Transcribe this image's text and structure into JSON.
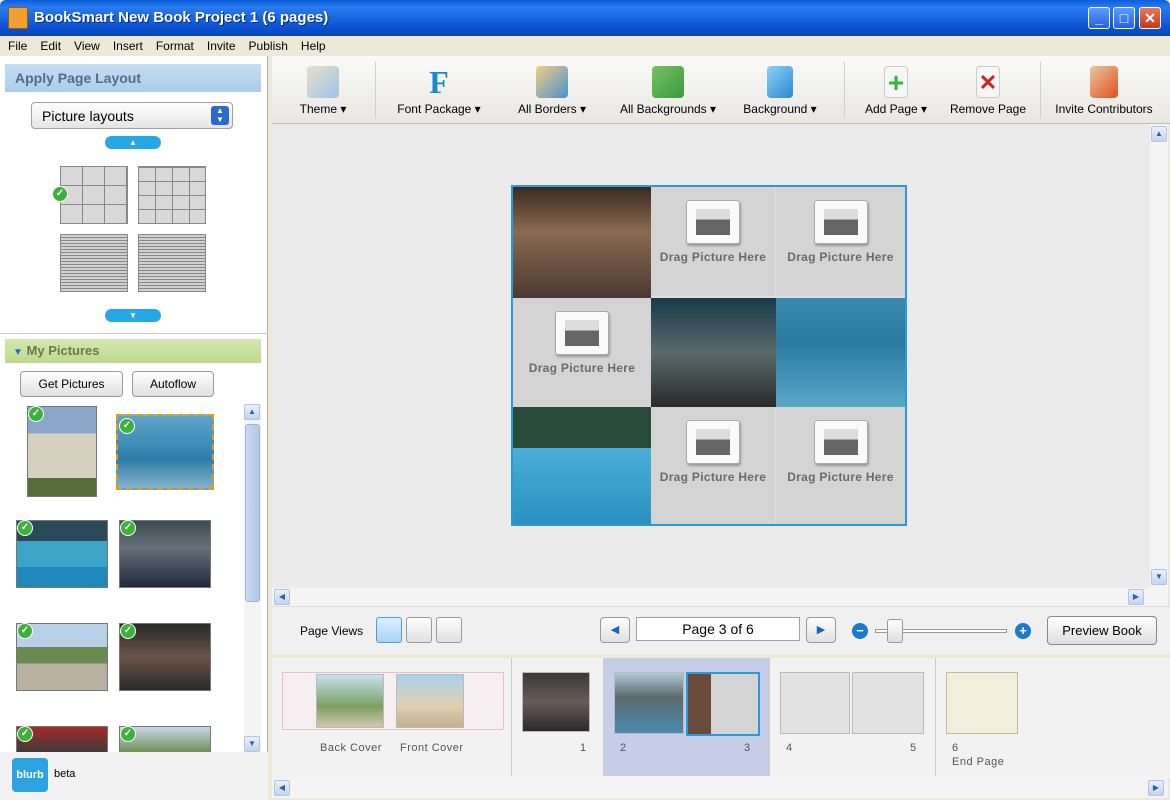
{
  "window": {
    "title": "BookSmart New Book Project 1 (6 pages)"
  },
  "menu": [
    "File",
    "Edit",
    "View",
    "Insert",
    "Format",
    "Invite",
    "Publish",
    "Help"
  ],
  "left_panel": {
    "apply_layout_title": "Apply Page Layout",
    "layout_select": "Picture layouts",
    "my_pictures_title": "My Pictures",
    "get_pictures_label": "Get Pictures",
    "autoflow_label": "Autoflow",
    "blurb_logo": "blurb",
    "blurb_beta": "beta"
  },
  "toolbar": {
    "theme": "Theme ▾",
    "font_package": "Font Package ▾",
    "all_borders": "All Borders ▾",
    "all_backgrounds": "All Backgrounds ▾",
    "background": "Background ▾",
    "add_page": "Add Page ▾",
    "remove_page": "Remove Page",
    "invite_contributors": "Invite Contributors"
  },
  "canvas": {
    "placeholder_text": "Drag Picture Here"
  },
  "page_views": {
    "label": "Page Views",
    "page_indicator": "Page 3 of 6",
    "preview_label": "Preview Book"
  },
  "filmstrip": {
    "back_cover": "Back Cover",
    "front_cover": "Front Cover",
    "p1": "1",
    "p2": "2",
    "p3": "3",
    "p4": "4",
    "p5": "5",
    "p6": "6",
    "end_page": "End Page"
  },
  "colors": {
    "accent": "#2a9ae0",
    "title_bar": "#0a5fd8",
    "selected_spread": "#c6cde6",
    "check": "#3cb23c"
  }
}
